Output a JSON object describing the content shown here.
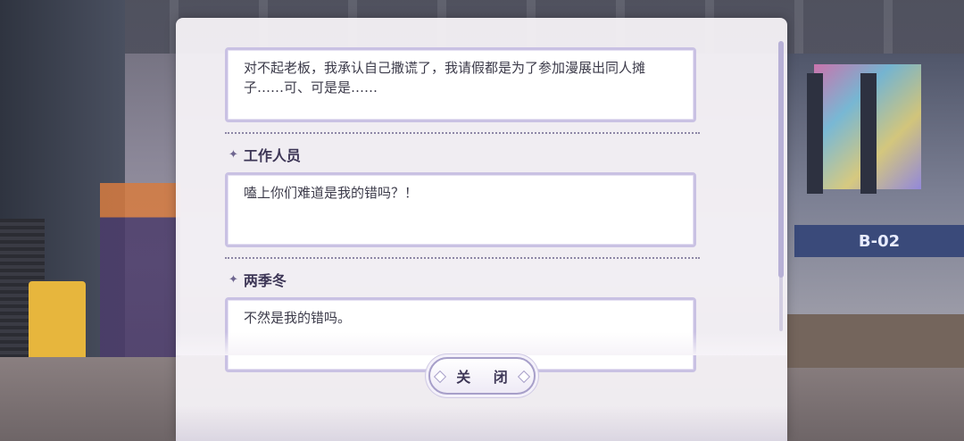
{
  "background": {
    "booth_sign": "B-02"
  },
  "dialog_log": {
    "entries": [
      {
        "speaker": "",
        "text": "对不起老板，我承认自己撒谎了，我请假都是为了参加漫展出同人摊子……可、可是是……"
      },
      {
        "speaker": "工作人员",
        "text": "嗑上你们难道是我的错吗？！"
      },
      {
        "speaker": "两季冬",
        "text": "不然是我的错吗。"
      }
    ],
    "close_label": "关 闭"
  },
  "colors": {
    "accent": "#a79fc9",
    "text_dark": "#3d3656"
  }
}
